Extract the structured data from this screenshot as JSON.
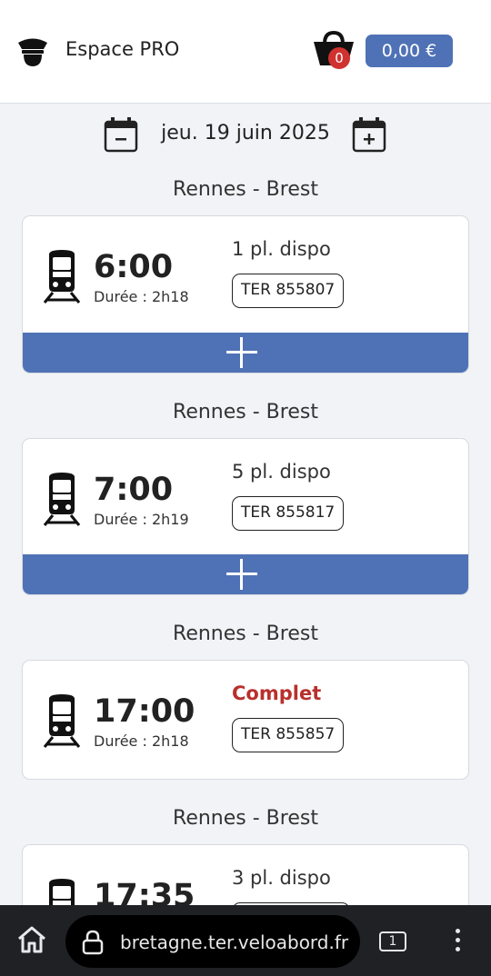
{
  "header": {
    "pro_label": "Espace PRO",
    "basket_count": "0",
    "price": "0,00 €"
  },
  "date": {
    "text": "jeu. 19 juin 2025"
  },
  "trips": [
    {
      "route": "Rennes - Brest",
      "time": "6:00",
      "duration": "Durée : 2h18",
      "seats": "1 pl. dispo",
      "train": "TER 855807"
    },
    {
      "route": "Rennes - Brest",
      "time": "7:00",
      "duration": "Durée : 2h19",
      "seats": "5 pl. dispo",
      "train": "TER 855817"
    },
    {
      "route": "Rennes - Brest",
      "time": "17:00",
      "duration": "Durée : 2h18",
      "seats": "Complet",
      "train": "TER 855857"
    },
    {
      "route": "Rennes - Brest",
      "time": "17:35",
      "duration": "",
      "seats": "3 pl. dispo",
      "train": ""
    }
  ],
  "browser": {
    "url": "bretagne.ter.veloabord.fr",
    "tab_count": "1"
  },
  "colors": {
    "accent": "#4f72b6",
    "full": "#b9302c",
    "badge_red": "#d0322f"
  }
}
